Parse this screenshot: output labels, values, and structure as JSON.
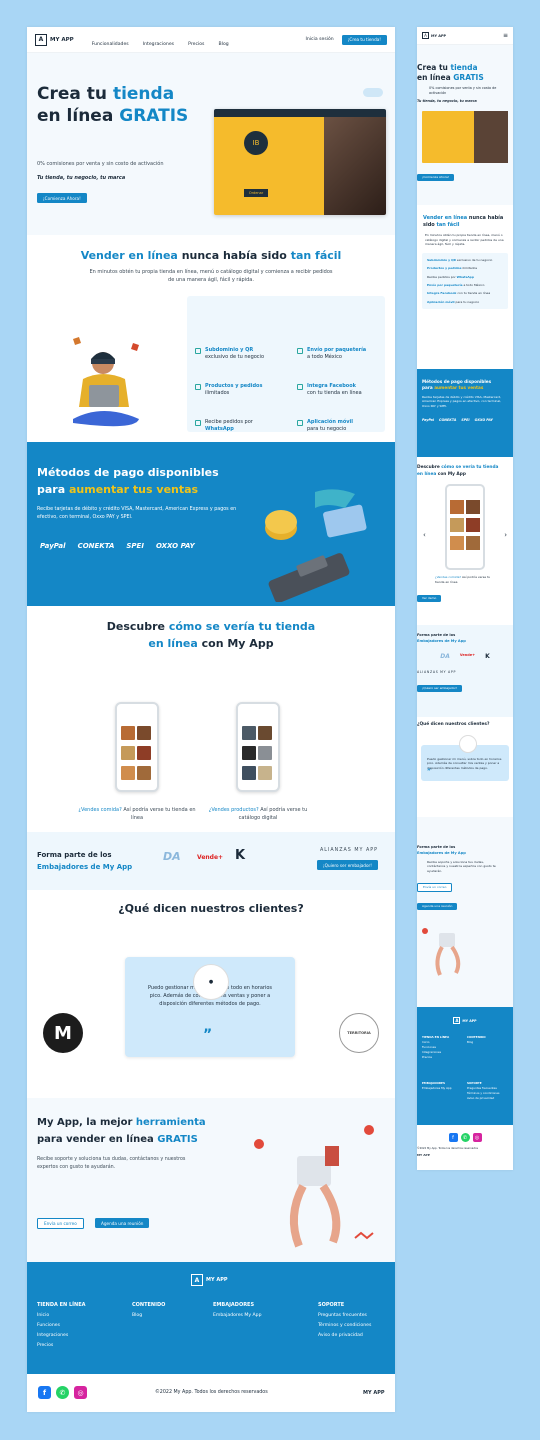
{
  "brand": {
    "name": "MY APP",
    "logo_letter": "A"
  },
  "nav": {
    "items": [
      "Funcionalidades",
      "Integraciones",
      "Precios",
      "Blog"
    ],
    "login": "Inicia sesión",
    "cta": "¡Crea tu tienda!"
  },
  "hero": {
    "title_1": "Crea tu ",
    "title_hl": "tienda",
    "title_2": "en línea ",
    "title_hl2": "GRATIS",
    "subtitle": "0% comisiones por venta y sin costo de activación",
    "tagline": "Tu tienda, tu negocio, tu marca",
    "cta": "¡Comienza Ahora!",
    "mock_button": "Ordenar"
  },
  "features": {
    "title_1": "Vender en línea",
    "title_2": " nunca había sido ",
    "title_3": "tan fácil",
    "desc": "En minutos obtén tu propia tienda en línea, menú o catálogo digital y comienza a recibir pedidos de una manera ágil, fácil y rápida.",
    "items": [
      {
        "b": "Subdominio y QR",
        "t": "exclusivo de tu negocio"
      },
      {
        "b": "Envío por paquetería",
        "t": "a todo México"
      },
      {
        "b": "Productos y pedidos",
        "t": "ilimitados"
      },
      {
        "b": "Integra Facebook",
        "t": "con tu tienda en línea"
      },
      {
        "b": "WhatsApp",
        "t": "Recibe pedidos por"
      },
      {
        "b": "Aplicación móvil",
        "t": "para tu negocio"
      }
    ]
  },
  "payments": {
    "title_1": "Métodos de pago disponibles",
    "title_2": "para ",
    "title_hl": "aumentar tus ventas",
    "desc": "Recibe tarjetas de débito y crédito VISA, Mastercard, American Express y pagos en efectivo, con terminal, Oxxo PAY y SPEI.",
    "logos": [
      "PayPal",
      "CONEKTA",
      "SPEI",
      "OXXO PAY"
    ]
  },
  "discover": {
    "title_1": "Descubre ",
    "title_hl": "cómo se vería tu tienda",
    "title_2": "en línea",
    "title_3": " con My App",
    "cards": [
      {
        "q": "¿Vendes comida?",
        "t": "Así podría verse tu tienda en línea",
        "btn": "Ver demo"
      },
      {
        "q": "¿Vendes productos?",
        "t": "Así podría verse tu catálogo digital",
        "btn": "Ver demo"
      }
    ]
  },
  "ambassadors": {
    "title_1": "Forma parte de los",
    "title_2": "Embajadores de My App",
    "alliances": "ALIANZAS MY APP",
    "cta": "¡Quiero ser embajador!",
    "logos": [
      "DA",
      "Vende+",
      "K"
    ]
  },
  "testimonials": {
    "title": "¿Qué dicen nuestros clientes?",
    "quote": "Puedo gestionar mi menú, sobre todo en horarios pico. Además de consultar mis ventas y poner a disposición diferentes métodos de pago.",
    "left": "M",
    "right": "TERRITORIA"
  },
  "cta": {
    "title_1": "My App, la mejor ",
    "title_hl": "herramienta",
    "title_2": "para vender en línea ",
    "title_hl2": "GRATIS",
    "desc": "Recibe soporte y soluciona tus dudas, contáctanos y nuestros expertos con gusto te ayudarán.",
    "btn_email": "Envía un correo",
    "btn_meet": "Agenda una reunión"
  },
  "footer": {
    "cols": [
      {
        "h": "TIENDA EN LÍNEA",
        "items": [
          "Inicio",
          "Funciones",
          "Integraciones",
          "Precios"
        ]
      },
      {
        "h": "CONTENIDO",
        "items": [
          "Blog"
        ]
      },
      {
        "h": "EMBAJADORES",
        "items": [
          "Embajadores My App"
        ]
      },
      {
        "h": "SOPORTE",
        "items": [
          "Preguntas frecuentes",
          "Términos y condiciones",
          "Aviso de privacidad"
        ]
      }
    ],
    "copyright": "©2022 My App. Todos los derechos reservados",
    "brand": "MY APP"
  },
  "mobile": {
    "copyright": "©2022 My App. Todos los derechos reservados",
    "brand": "MY APP"
  },
  "colors": {
    "primary": "#1487c6",
    "accent": "#f0c419",
    "bg": "#a9d6f5"
  }
}
